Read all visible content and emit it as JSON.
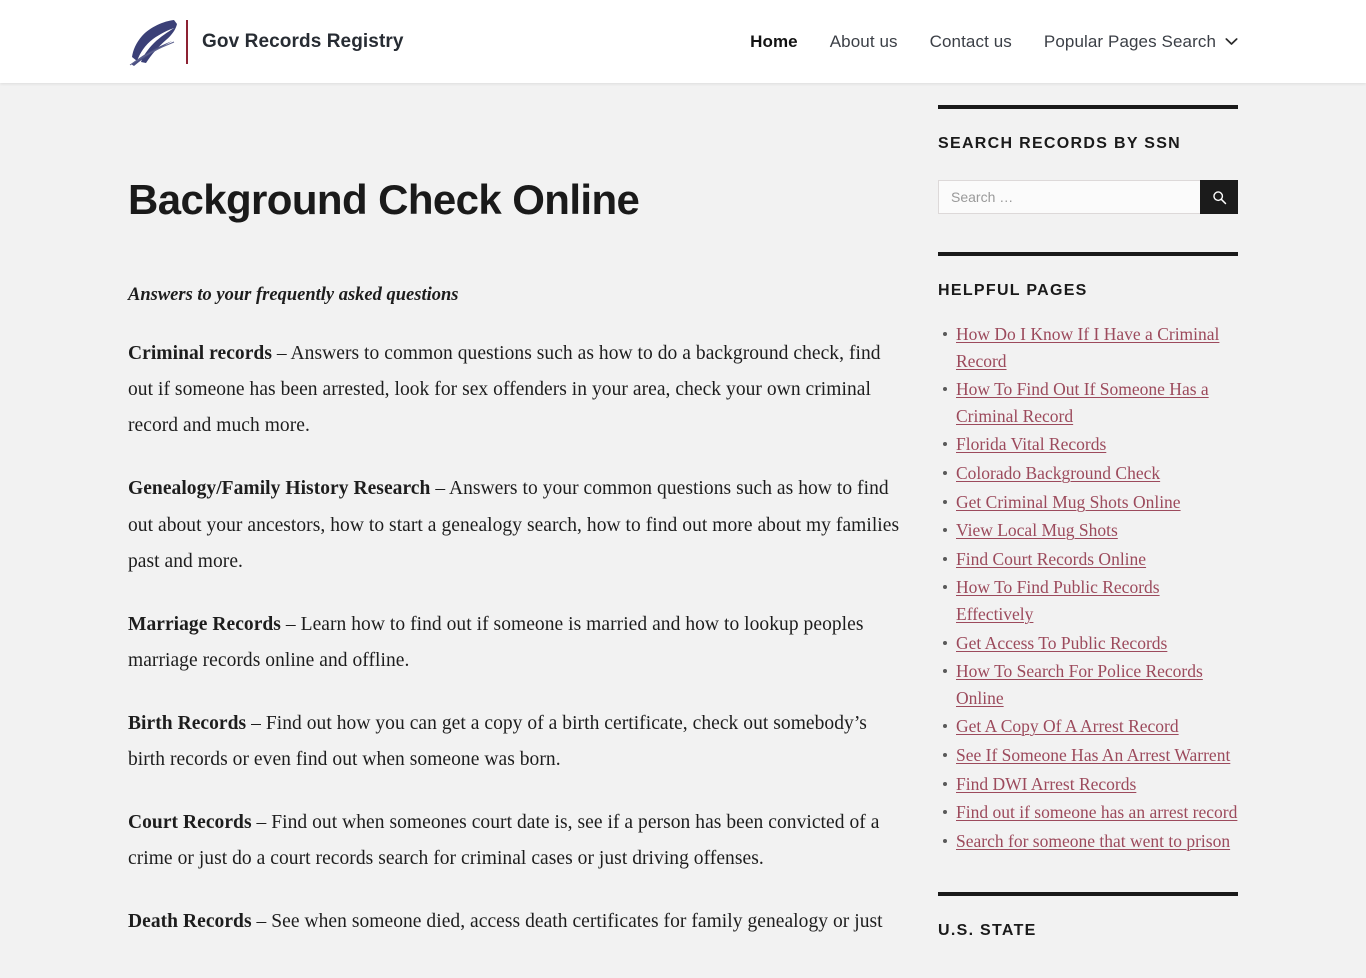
{
  "header": {
    "brand_name": "Gov Records Registry",
    "logo_icon": "quill-feather-icon",
    "nav": [
      {
        "label": "Home",
        "active": true
      },
      {
        "label": "About us",
        "active": false
      },
      {
        "label": "Contact us",
        "active": false
      }
    ],
    "dropdown": {
      "label": "Popular Pages Search",
      "icon": "chevron-down-icon"
    }
  },
  "article": {
    "title": "Background Check Online",
    "lede": "Answers to your frequently asked questions",
    "paragraphs": [
      {
        "term": "Criminal records",
        "body": " – Answers to common questions such as how to do a background check, find out if someone has been arrested, look for sex offenders in your area, check your own criminal record and much more."
      },
      {
        "term": "Genealogy/Family History Research",
        "body": " – Answers to your common questions such as how to find out about your ancestors, how to start a genealogy search, how to find out more about my families past and more."
      },
      {
        "term": "Marriage Records",
        "body": " – Learn how to find out if someone is married and how to lookup peoples marriage records online and offline."
      },
      {
        "term": "Birth Records",
        "body": " – Find out how you can get a copy of a birth certificate, check out somebody’s birth records or even find out when someone was born."
      },
      {
        "term": "Court Records",
        "body": " – Find out when someones court date is, see if a person has been convicted of a crime or just do a court records search for criminal cases or just driving offenses."
      },
      {
        "term": "Death Records",
        "body": " – See when someone died, access death certificates for family genealogy or just"
      }
    ]
  },
  "sidebar": {
    "search_widget": {
      "title": "Search Records by SSN",
      "input_value": "",
      "placeholder": "Search …",
      "submit_icon": "search-icon"
    },
    "helpful_widget": {
      "title": "Helpful Pages",
      "links": [
        "How Do I Know If I Have a Criminal Record",
        "How To Find Out If Someone Has a Criminal Record",
        "Florida Vital Records",
        "Colorado Background Check",
        "Get Criminal Mug Shots Online",
        "View Local Mug Shots",
        "Find Court Records Online",
        "How To Find Public Records Effectively",
        "Get Access To Public Records",
        "How To Search For Police Records Online",
        "Get A Copy Of A Arrest Record",
        "See If Someone Has An Arrest Warrent",
        "Find DWI Arrest Records",
        "Find out if someone has an arrest record",
        "Search for someone that went to prison"
      ]
    },
    "state_widget": {
      "title": "U.S. State"
    }
  },
  "colors": {
    "page_background": "#f2f2f2",
    "header_background": "#ffffff",
    "link": "#9c4a5c",
    "brand_divider": "#8d2233",
    "logo_feather": "#3b4077",
    "rule": "#1a1a1a",
    "search_button": "#1b1b1b"
  }
}
